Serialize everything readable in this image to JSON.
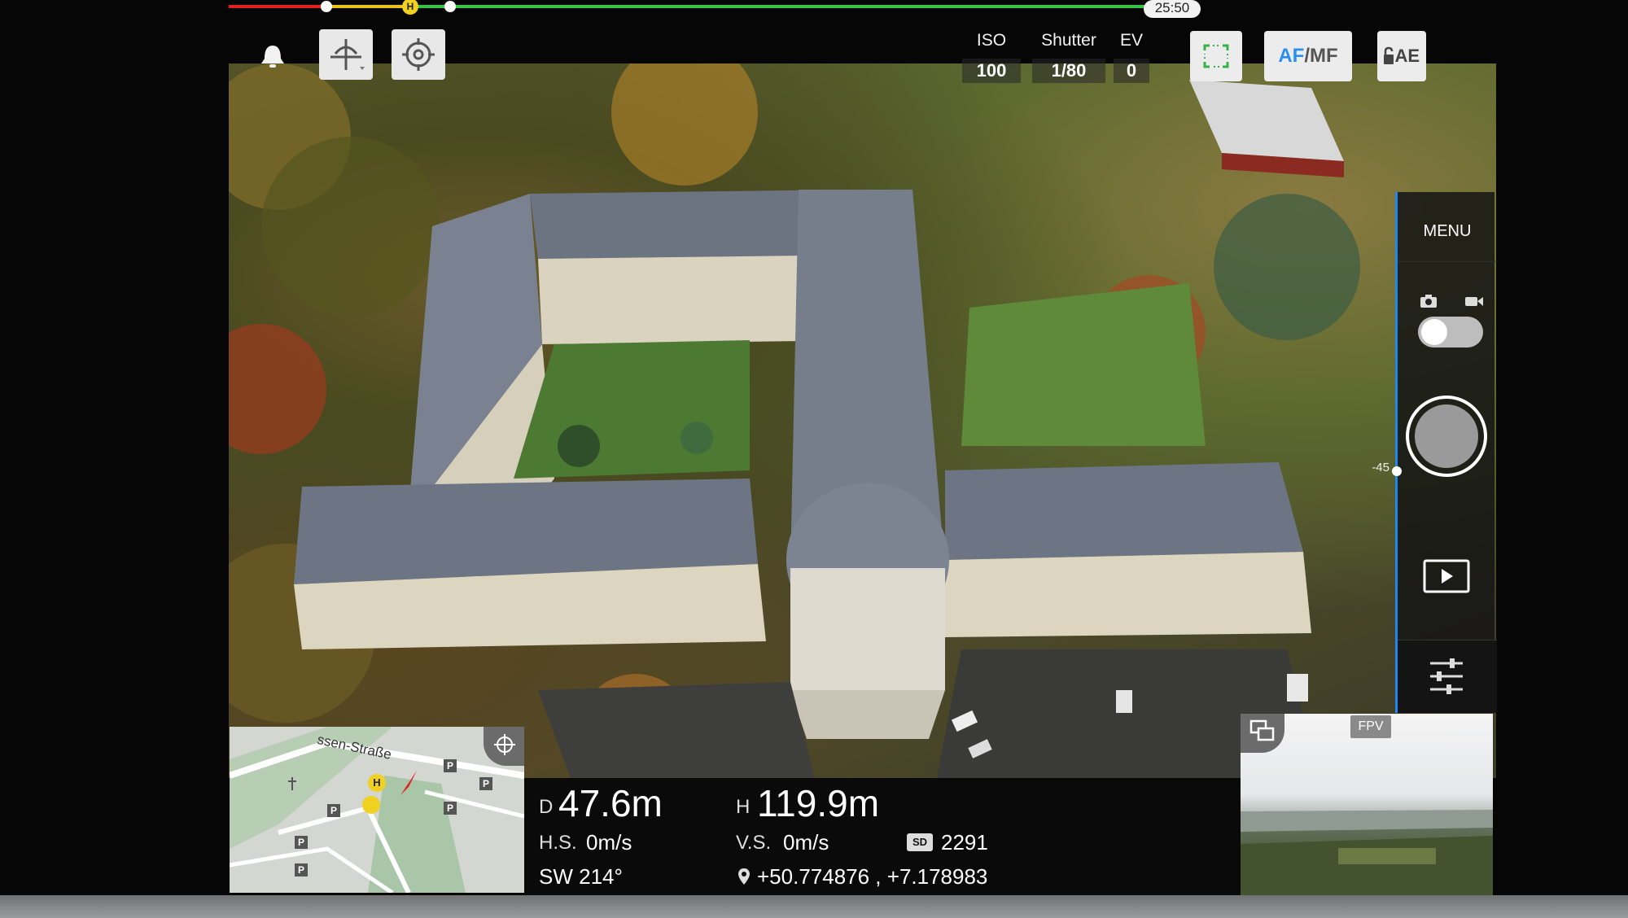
{
  "top_bar": {
    "flight_time": "25:50",
    "home_marker": "H",
    "icons": [
      "bell-icon",
      "gimbal-mode-icon",
      "target-icon"
    ]
  },
  "exposure": {
    "iso_label": "ISO",
    "iso_value": "100",
    "shutter_label": "Shutter",
    "shutter_value": "1/80",
    "ev_label": "EV",
    "ev_value": "0"
  },
  "camera_controls": {
    "af_label": "AF",
    "mf_label": "/MF",
    "ae_label": "AE",
    "focus_frame_icon": "focus-frame-icon",
    "lock_icon": "lock-icon"
  },
  "right_panel": {
    "menu_label": "MENU",
    "gimbal_angle": "-45",
    "photo_icon": "camera-icon",
    "video_icon": "video-icon",
    "playback_icon": "playback-icon",
    "settings_icon": "sliders-icon"
  },
  "map": {
    "street_name": "ssen-Straße",
    "home_marker": "H",
    "parking_label": "P",
    "locate_icon": "crosshair-icon"
  },
  "telemetry": {
    "distance_prefix": "D",
    "distance": "47.6m",
    "height_prefix": "H",
    "height": "119.9m",
    "hs_label": "H.S.",
    "hs_value": "0m/s",
    "vs_label": "V.S.",
    "vs_value": "0m/s",
    "heading": "SW 214°",
    "sd_label": "SD",
    "sd_value": "2291",
    "coordinates": "+50.774876 , +7.178983"
  },
  "fpv": {
    "label": "FPV",
    "swap_icon": "swap-view-icon"
  },
  "colors": {
    "accent_blue": "#1e88f0",
    "battery_red": "#e02020",
    "battery_yellow": "#e8c21c",
    "battery_green": "#37c24a"
  }
}
